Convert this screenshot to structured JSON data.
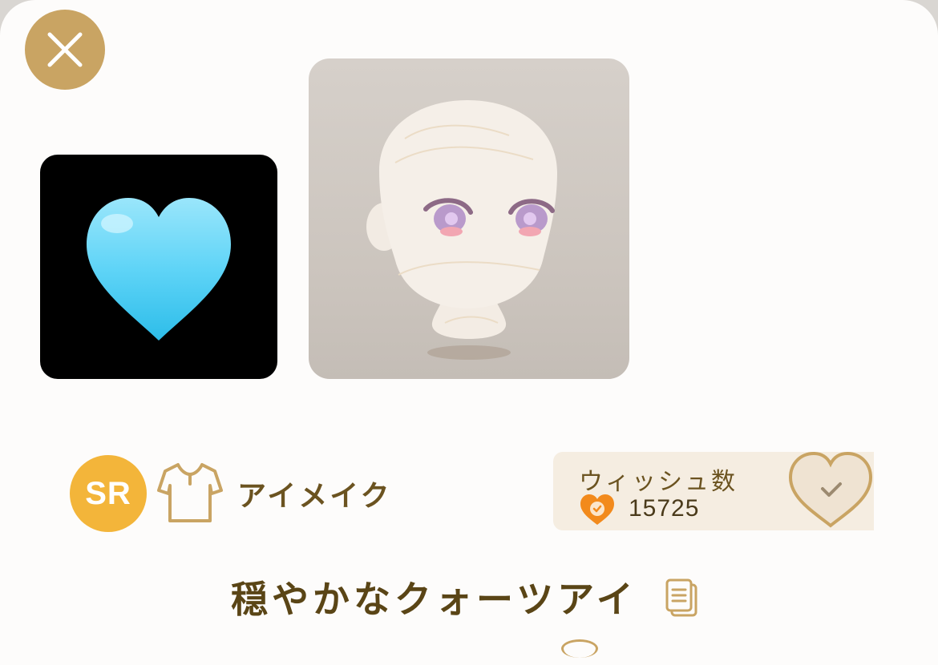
{
  "dialog": {
    "close_icon": "close-icon"
  },
  "thumbnail": {
    "icon": "light-blue-heart-icon",
    "background": "#000000",
    "heart_color": "#5fd4f7"
  },
  "preview": {
    "alt": "eye-makeup-preview"
  },
  "item": {
    "rarity": "SR",
    "rarity_color": "#f3b53a",
    "category_icon": "shirt-icon",
    "category": "アイメイク",
    "name": "穏やかなクォーツアイ",
    "copy_icon": "copy-icon"
  },
  "wish": {
    "title": "ウィッシュ数",
    "count": "15725",
    "count_icon": "orange-heart-check-icon",
    "button_icon": "heart-check-icon"
  },
  "colors": {
    "accent_gold": "#c9a463",
    "text_brown": "#6b5320",
    "wish_orange": "#f28a1c"
  }
}
